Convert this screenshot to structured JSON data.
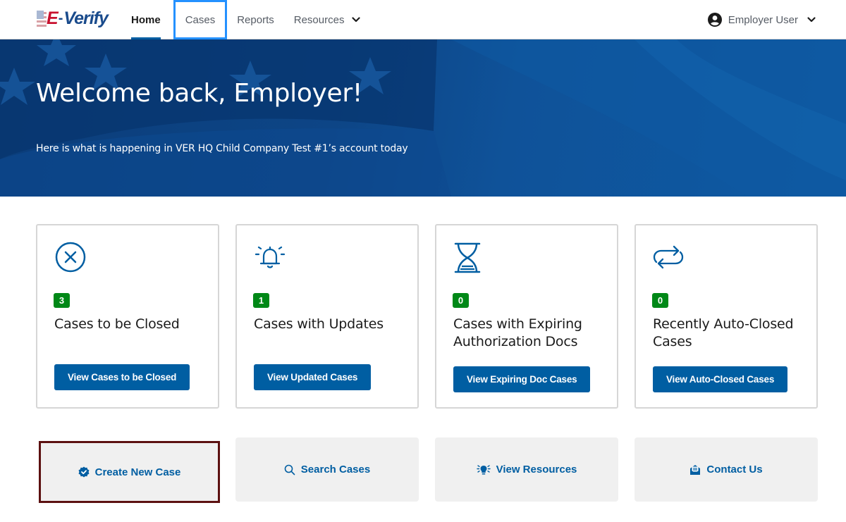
{
  "header": {
    "logo": {
      "prefix": "E",
      "dash": "-",
      "word": "Verify"
    },
    "nav": [
      {
        "label": "Home",
        "active": true
      },
      {
        "label": "Cases",
        "focused": true
      },
      {
        "label": "Reports"
      },
      {
        "label": "Resources",
        "has_dropdown": true
      }
    ],
    "user_menu": {
      "label": "Employer User",
      "icon": "user-circle-icon"
    }
  },
  "hero": {
    "title": "Welcome back, Employer!",
    "subtitle": "Here is what is happening in VER HQ Child Company Test #1’s account today"
  },
  "cards": [
    {
      "icon": "close-circle-icon",
      "count": "3",
      "title": "Cases to be Closed",
      "button": "View Cases to be Closed"
    },
    {
      "icon": "bell-icon",
      "count": "1",
      "title": "Cases with Updates",
      "button": "View Updated Cases"
    },
    {
      "icon": "hourglass-icon",
      "count": "0",
      "title": "Cases with Expiring Authorization Docs",
      "button": "View Expiring Doc Cases"
    },
    {
      "icon": "repeat-icon",
      "count": "0",
      "title": "Recently Auto-Closed Cases",
      "button": "View Auto-Closed Cases"
    }
  ],
  "quick_links": [
    {
      "icon": "verified-badge-icon",
      "label": "Create New Case",
      "selected": true
    },
    {
      "icon": "search-icon",
      "label": "Search Cases"
    },
    {
      "icon": "lightbulb-icon",
      "label": "View Resources"
    },
    {
      "icon": "mail-open-icon",
      "label": "Contact Us"
    }
  ],
  "colors": {
    "primary": "#005ea2",
    "badge_green": "#008817",
    "hero_blue": "#0d4586",
    "focus_outline": "#2491ff",
    "selected_outline": "#5c1111"
  }
}
